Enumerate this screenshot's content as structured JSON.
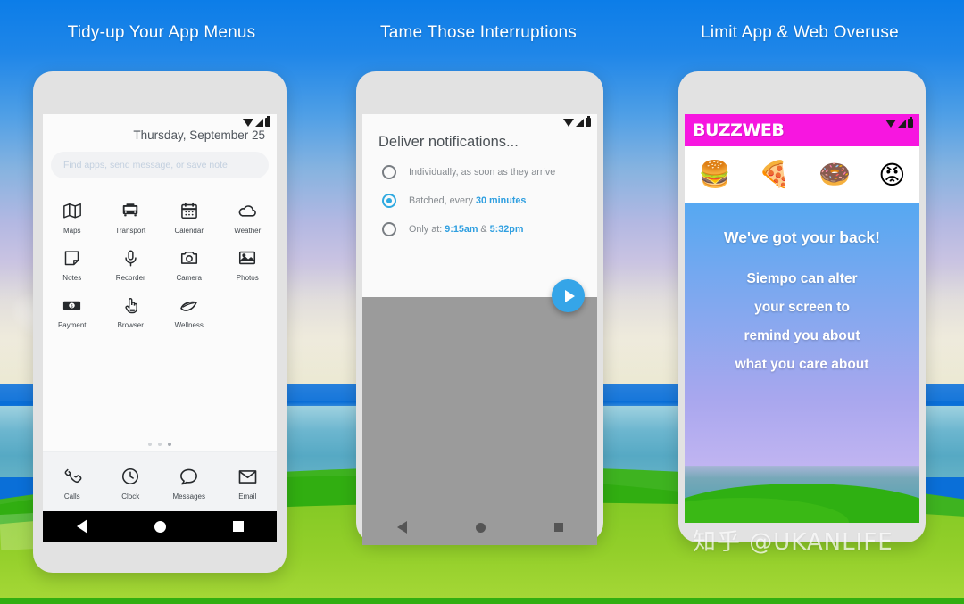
{
  "captions": {
    "one": "Tidy-up Your App Menus",
    "two": "Tame Those Interruptions",
    "three": "Limit App & Web Overuse"
  },
  "phone1": {
    "date": "Thursday, September 25",
    "search_placeholder": "Find apps, send message, or save note",
    "apps_row1": [
      {
        "label": "Maps",
        "icon": "map-icon"
      },
      {
        "label": "Transport",
        "icon": "bus-icon"
      },
      {
        "label": "Calendar",
        "icon": "calendar-icon"
      },
      {
        "label": "Weather",
        "icon": "cloud-icon"
      }
    ],
    "apps_row2": [
      {
        "label": "Notes",
        "icon": "note-icon"
      },
      {
        "label": "Recorder",
        "icon": "microphone-icon"
      },
      {
        "label": "Camera",
        "icon": "camera-icon"
      },
      {
        "label": "Photos",
        "icon": "photo-icon"
      }
    ],
    "apps_row3": [
      {
        "label": "Payment",
        "icon": "banknote-icon"
      },
      {
        "label": "Browser",
        "icon": "pointing-hand-icon"
      },
      {
        "label": "Wellness",
        "icon": "leaf-icon"
      }
    ],
    "dock": [
      {
        "label": "Calls",
        "icon": "phone-handset-icon"
      },
      {
        "label": "Clock",
        "icon": "clock-icon"
      },
      {
        "label": "Messages",
        "icon": "speech-bubble-icon"
      },
      {
        "label": "Email",
        "icon": "envelope-icon"
      }
    ],
    "page_dots": 3,
    "active_dot": 3
  },
  "phone2": {
    "title": "Deliver notifications...",
    "options": [
      {
        "selected": false,
        "text": "Individually, as soon as they arrive",
        "pre": "Individually, as soon as they arrive",
        "hi": "",
        "post": ""
      },
      {
        "selected": true,
        "text": "Batched, every 30 minutes",
        "pre": "Batched, every ",
        "hi": "30 minutes",
        "post": ""
      },
      {
        "selected": false,
        "text": "Only at: 9:15am & 5:32pm",
        "pre": "Only at: ",
        "hi": "9:15am",
        "mid": " & ",
        "hi2": "5:32pm",
        "post": ""
      }
    ],
    "fab": "play-button"
  },
  "phone3": {
    "app_name": "BUZZWEB",
    "emoji": [
      "🍔",
      "🍕",
      "🍩",
      "😡"
    ],
    "emoji_names": [
      "hamburger-emoji",
      "pizza-emoji",
      "donut-emoji",
      "angry-face-emoji"
    ],
    "heading": "We've got your back!",
    "lines": [
      "Siempo can alter",
      "your screen to",
      "remind you about",
      "what you care about"
    ]
  },
  "watermark": "知乎 @UKANLIFE",
  "colors": {
    "accent_blue": "#2f9fe0",
    "buzzweb_magenta": "#f716e0",
    "sky_blue": "#0c7de8",
    "grass_green": "#3eb320"
  }
}
